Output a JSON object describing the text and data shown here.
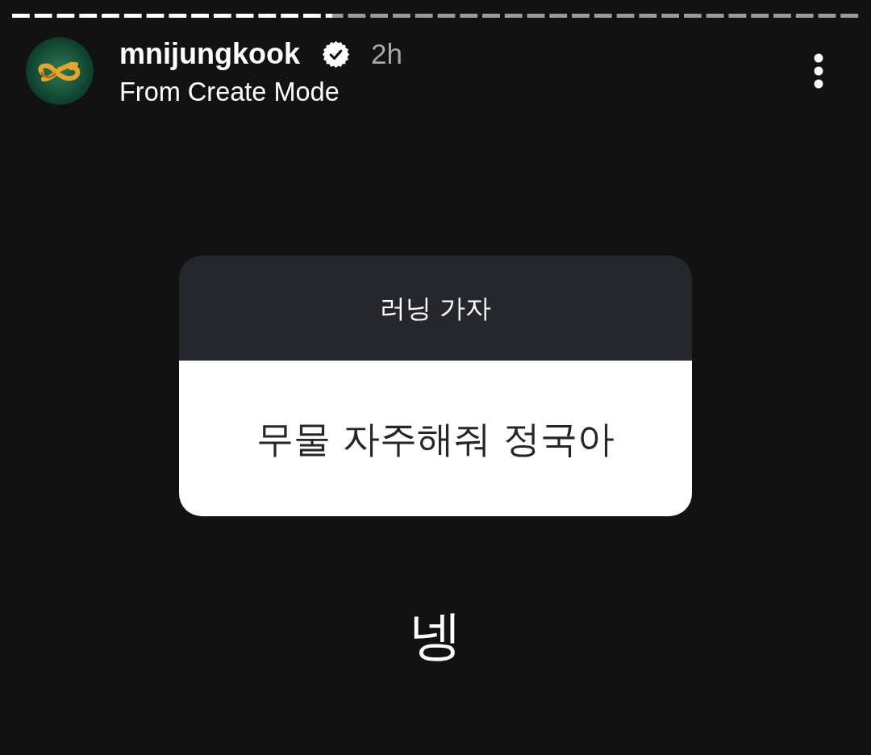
{
  "story_progress": {
    "level": 0.378
  },
  "header": {
    "username": "mnijungkook",
    "verified": true,
    "time": "2h",
    "subtitle": "From Create Mode"
  },
  "question_sticker": {
    "prompt": "러닝 가자",
    "question": "무물 자주해줘 정국아"
  },
  "caption": "넹"
}
